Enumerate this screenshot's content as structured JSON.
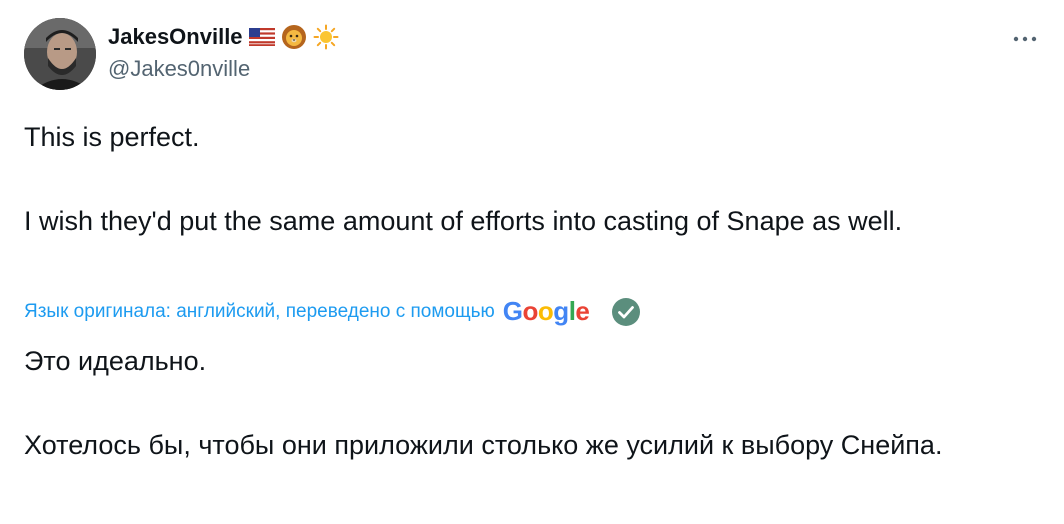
{
  "author": {
    "display_name": "JakesOnville",
    "handle": "@Jakes0nville",
    "badges": [
      "us-flag-emoji",
      "lion-emoji",
      "sun-emoji"
    ]
  },
  "menu": {
    "more_icon": "more-horizontal-icon"
  },
  "tweet": {
    "line1": "This is perfect.",
    "line2": "I wish they'd put the same amount of efforts into casting of Snape as well."
  },
  "translation": {
    "label": "Язык оригинала: английский, переведено с помощью",
    "provider": {
      "letters": [
        "G",
        "o",
        "o",
        "g",
        "l",
        "e"
      ],
      "colors": [
        "#4285f4",
        "#ea4335",
        "#fbbc05",
        "#4285f4",
        "#34a853",
        "#ea4335"
      ]
    },
    "line1": "Это идеально.",
    "line2": "Хотелось бы, чтобы они приложили столько же усилий к выбору Снейпа."
  },
  "colors": {
    "text": "#0f1419",
    "secondary": "#536471",
    "link": "#1d9bf0",
    "check": "#5b8e7d"
  }
}
